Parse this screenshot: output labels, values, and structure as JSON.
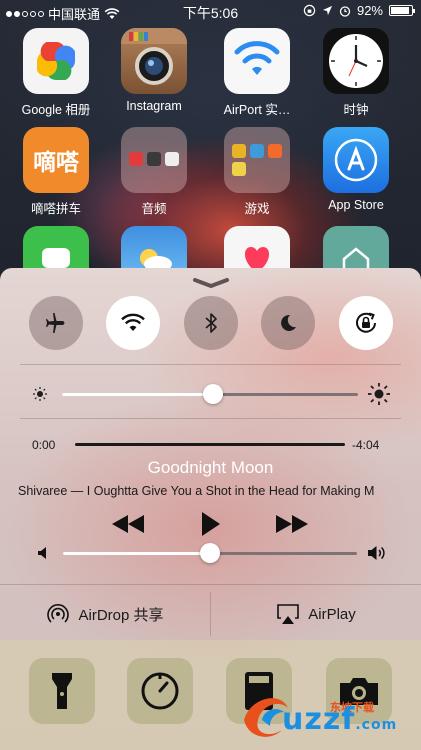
{
  "status_bar": {
    "carrier": "中国联通",
    "time": "下午5:06",
    "battery": "92%",
    "battery_level": 0.92
  },
  "home_apps": [
    {
      "label": "Google 相册",
      "icon": "google-photos-icon"
    },
    {
      "label": "Instagram",
      "icon": "instagram-icon"
    },
    {
      "label": "AirPort 实…",
      "icon": "airport-utility-icon"
    },
    {
      "label": "时钟",
      "icon": "clock-icon"
    },
    {
      "label": "嘀嗒拼车",
      "icon": "dida-carpool-icon",
      "icon_text": "嘀嗒"
    },
    {
      "label": "音频",
      "icon": "audio-folder-icon"
    },
    {
      "label": "游戏",
      "icon": "games-folder-icon"
    },
    {
      "label": "App Store",
      "icon": "app-store-icon"
    }
  ],
  "control_center": {
    "toggles": [
      {
        "name": "airplane-mode",
        "icon": "airplane-icon",
        "on": false
      },
      {
        "name": "wifi",
        "icon": "wifi-icon",
        "on": true
      },
      {
        "name": "bluetooth",
        "icon": "bluetooth-icon",
        "on": false
      },
      {
        "name": "do-not-disturb",
        "icon": "moon-icon",
        "on": false
      },
      {
        "name": "rotation-lock",
        "icon": "rotation-lock-icon",
        "on": true
      }
    ],
    "brightness": 0.51,
    "music": {
      "elapsed": "0:00",
      "remaining": "-4:04",
      "progress": 0.0,
      "title": "Goodnight Moon",
      "artist_line": "Shivaree — I Oughtta Give You a Shot in the Head for Making M"
    },
    "volume": 0.5,
    "airdrop_label": "AirDrop 共享",
    "airplay_label": "AirPlay",
    "quick_actions": [
      "flashlight-icon",
      "timer-icon",
      "calculator-icon",
      "camera-icon"
    ]
  },
  "watermark": {
    "text": "uzzf",
    "sub": "东坡下载",
    "suffix": ".com"
  }
}
